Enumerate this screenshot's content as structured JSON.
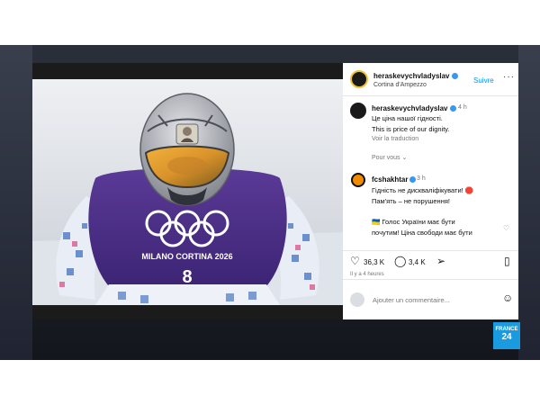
{
  "post": {
    "username": "heraskevychvladyslav",
    "location": "Cortina d'Ampezzo",
    "follow_label": "Suivre",
    "more_icon": "more-dots-icon"
  },
  "caption": {
    "username": "heraskevychvladyslav",
    "time": "4 h",
    "line1": "Це ціна нашої гідності.",
    "line2": "This is price of our dignity.",
    "translate": "Voir la traduction",
    "for_you": "Pour vous"
  },
  "comment": {
    "username": "fcshakhtar",
    "time": "3 h",
    "line1": "Гідність не дискваліфікувати! 🛑",
    "line2": "Пам'ять – не порушення!",
    "line3": "🇺🇦 Голос України має бути",
    "line4": "почутим! Ціна свободи має бути"
  },
  "photo": {
    "olympic_text": "MILANO CORTINA 2026",
    "bib_number": "8"
  },
  "actions": {
    "likes": "36,3 K",
    "comments": "3,4 K",
    "time_ago": "Il y a 4 heures"
  },
  "comment_input": {
    "placeholder": "Ajouter un commentaire..."
  },
  "badge": {
    "line1": "FRANCE",
    "line2": "24"
  },
  "colors": {
    "accent_blue": "#0095f6",
    "suit_purple": "#4b2d86",
    "helmet_silver": "#b9bcc2"
  }
}
